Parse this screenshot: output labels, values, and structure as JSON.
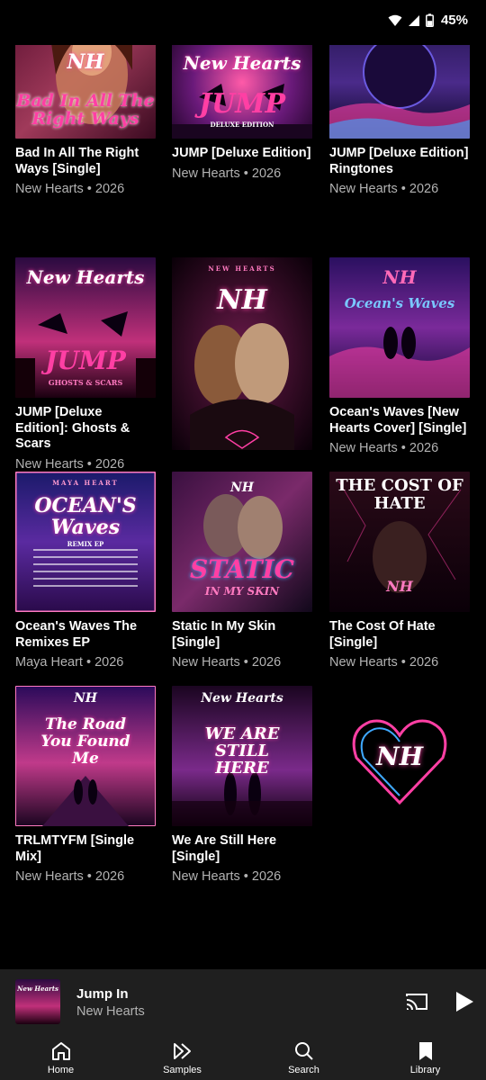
{
  "status_bar": {
    "battery": "45%"
  },
  "albums": [
    {
      "title": "Bad In All The Right Ways [Single]",
      "artist_year": "New Hearts • 2026",
      "art": {
        "top": "NH",
        "main": "Bad In All The Right Ways"
      }
    },
    {
      "title": "JUMP [Deluxe Edition]",
      "artist_year": "New Hearts • 2026",
      "art": {
        "top": "New Hearts",
        "main": "JUMP",
        "sub": "DELUXE EDITION"
      }
    },
    {
      "title": "JUMP [Deluxe Edition] Ringtones",
      "artist_year": "New Hearts • 2026",
      "art": {}
    },
    {
      "title": "JUMP [Deluxe Edition]: Ghosts & Scars",
      "artist_year": "New Hearts • 2026",
      "art": {
        "top": "New Hearts",
        "main": "JUMP",
        "sub": "GHOSTS & SCARS"
      }
    },
    {
      "title": "",
      "artist_year": "",
      "art": {
        "top": "NEW HEARTS",
        "main": "NH"
      }
    },
    {
      "title": "Ocean's Waves [New Hearts Cover] [Single]",
      "artist_year": "New Hearts • 2026",
      "art": {
        "top": "NH",
        "main": "Ocean's Waves"
      }
    },
    {
      "title": "Ocean's Waves The Remixes EP",
      "artist_year": "Maya Heart • 2026",
      "art": {
        "top": "MAYA HEART",
        "main": "OCEAN'S Waves",
        "sub": "REMIX EP"
      }
    },
    {
      "title": "Static In My Skin [Single]",
      "artist_year": "New Hearts • 2026",
      "art": {
        "top": "NH",
        "main": "STATIC",
        "sub": "IN MY SKIN"
      }
    },
    {
      "title": "The Cost Of Hate [Single]",
      "artist_year": "New Hearts • 2026",
      "art": {
        "top": "THE COST OF HATE",
        "main": "NH"
      }
    },
    {
      "title": "TRLMTYFM [Single Mix]",
      "artist_year": "New Hearts • 2026",
      "art": {
        "top": "NH",
        "main": "The Road You Found Me"
      }
    },
    {
      "title": "We Are Still Here [Single]",
      "artist_year": "New Hearts • 2026",
      "art": {
        "top": "New Hearts",
        "main": "WE ARE STILL HERE"
      }
    },
    {
      "title": "",
      "artist_year": "",
      "art": {
        "main": "NH"
      }
    }
  ],
  "colors": {
    "background": "#000000",
    "panel": "#1f1f1f",
    "secondary_text": "#b3b3b3",
    "neon_pink": "#ff3fa4",
    "neon_blue": "#3fa9ff"
  },
  "now_playing": {
    "title": "Jump In",
    "artist": "New Hearts",
    "art_text": "New Hearts",
    "cast_icon": "cast-icon",
    "play_icon": "play-icon"
  },
  "nav": [
    {
      "label": "Home",
      "icon": "home-icon"
    },
    {
      "label": "Samples",
      "icon": "samples-icon"
    },
    {
      "label": "Search",
      "icon": "search-icon"
    },
    {
      "label": "Library",
      "icon": "library-icon"
    }
  ]
}
